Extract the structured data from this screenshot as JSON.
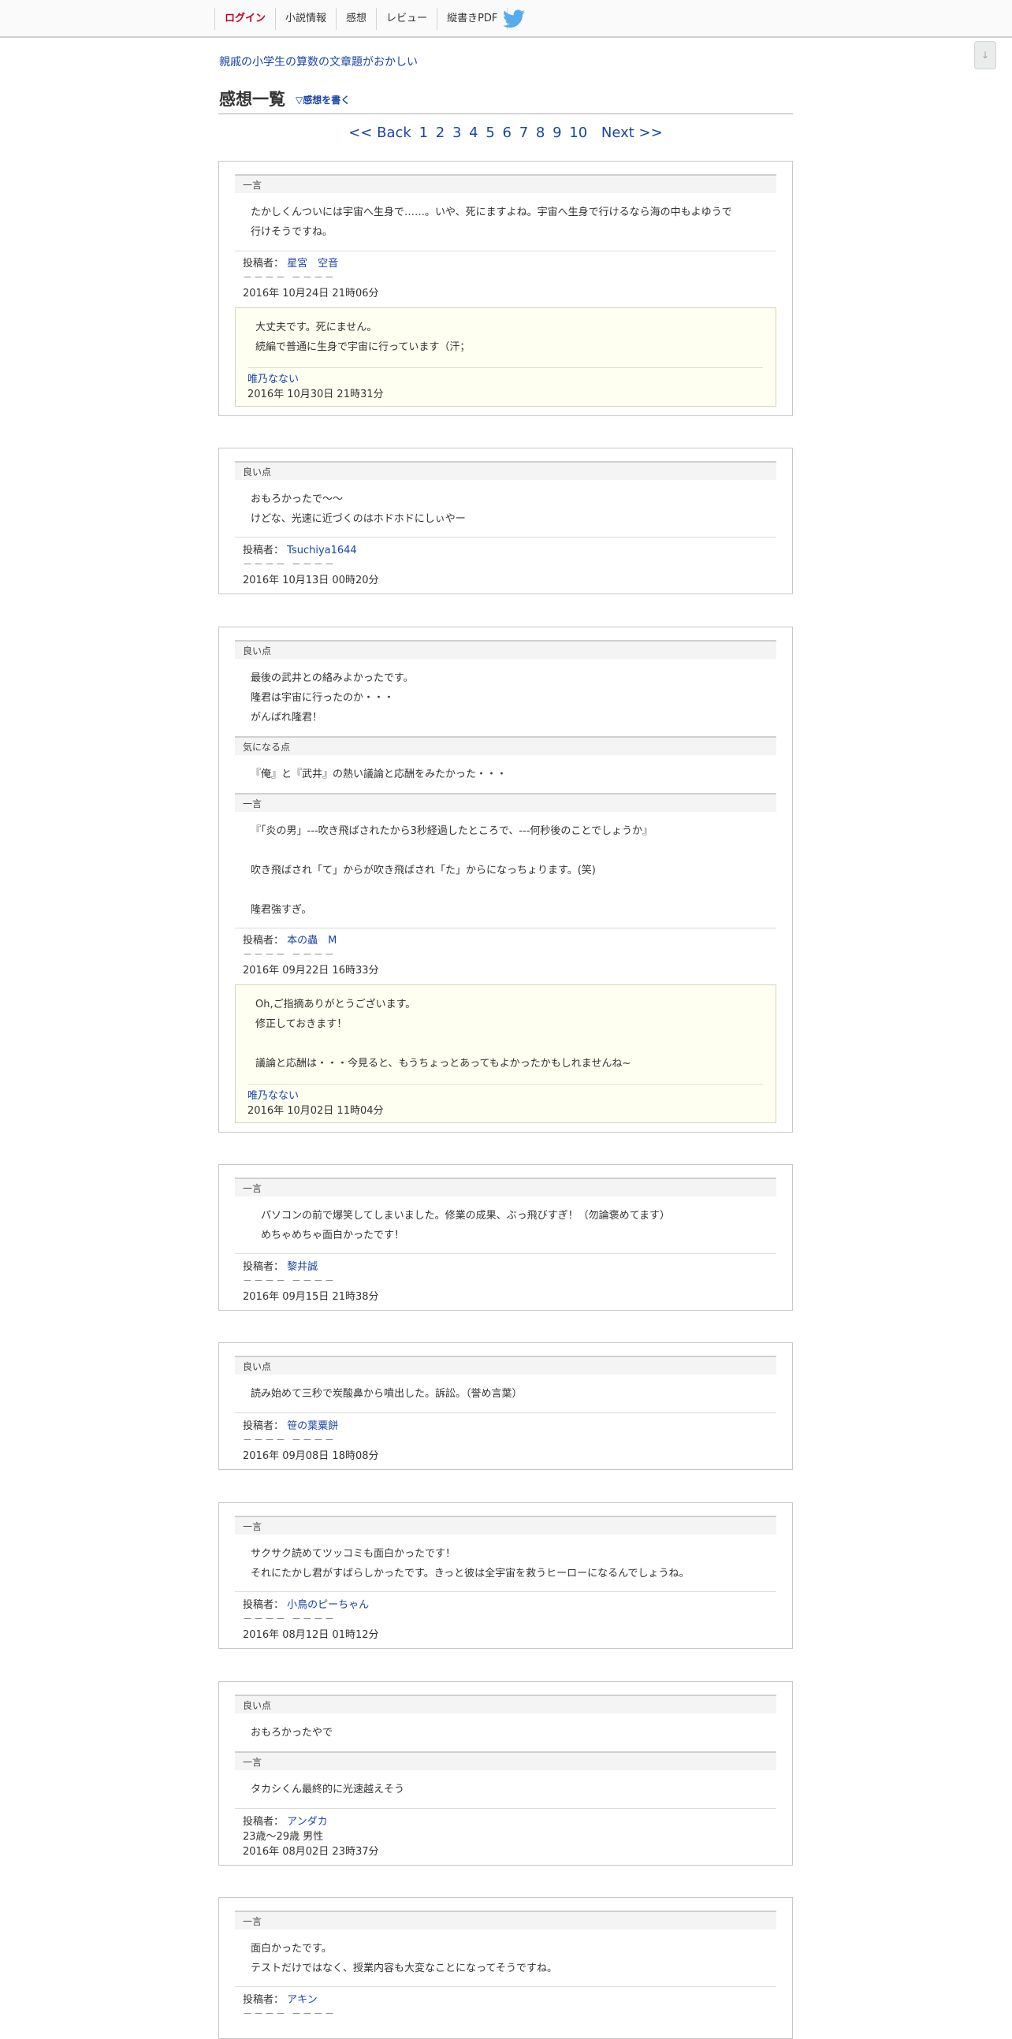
{
  "nav": {
    "items": [
      "ログイン",
      "小説情報",
      "感想",
      "レビュー",
      "縦書きPDF"
    ],
    "twitter_icon": "twitter-bird-icon",
    "twitter_color": "#55acee"
  },
  "scroll_button": "↓",
  "work_title": "親戚の小学生の算数の文章題がおかしい",
  "page_title": "感想一覧",
  "write_link": "▽感想を書く",
  "pager": {
    "back": "<< Back",
    "pages": [
      "1",
      "2",
      "3",
      "4",
      "5",
      "6",
      "7",
      "8",
      "9",
      "10"
    ],
    "next": "Next >>"
  },
  "labels": {
    "author_prefix": "投稿者："
  },
  "cards": [
    {
      "sections": [
        {
          "label": "一言",
          "text": "たかしくんついには宇宙へ生身で……。いや、死にますよね。宇宙へ生身で行けるなら海の中もよゆうで\n行けそうですね。"
        }
      ],
      "author": "星宮　空音",
      "meta": "－－－－ －－－－",
      "date": "2016年 10月24日 21時06分",
      "reply": {
        "text": "大丈夫です。死にません。\n続編で普通に生身で宇宙に行っています（汗；",
        "author": "唯乃なない",
        "date": "2016年 10月30日 21時31分"
      }
    },
    {
      "sections": [
        {
          "label": "良い点",
          "text": "おもろかったで～～\nけどな、光速に近づくのはホドホドにしぃやー"
        }
      ],
      "author": "Tsuchiya1644",
      "meta": "－－－－ －－－－",
      "date": "2016年 10月13日 00時20分"
    },
    {
      "sections": [
        {
          "label": "良い点",
          "text": "最後の武井との絡みよかったです。\n隆君は宇宙に行ったのか・・・\nがんばれ隆君！"
        },
        {
          "label": "気になる点",
          "text": "『俺』と『武井』の熱い議論と応酬をみたかった・・・"
        },
        {
          "label": "一言",
          "text": "『「炎の男」---吹き飛ばされたから3秒経過したところで、---何秒後のことでしょうか』\n\n吹き飛ばされ「て」からが吹き飛ばされ「た」からになっちょります。(笑)\n\n隆君強すぎ。"
        }
      ],
      "author": "本の蟲　M",
      "meta": "－－－－ －－－－",
      "date": "2016年 09月22日 16時33分",
      "reply": {
        "text": "Oh,ご指摘ありがとうございます。\n修正しておきます！\n\n議論と応酬は・・・今見ると、もうちょっとあってもよかったかもしれませんね~",
        "author": "唯乃なない",
        "date": "2016年 10月02日 11時04分"
      }
    },
    {
      "sections": [
        {
          "label": "一言",
          "text": "　パソコンの前で爆笑してしまいました。修業の成果、ぶっ飛びすぎ！（勿論褒めてます）\n　めちゃめちゃ面白かったです！"
        }
      ],
      "author": "黎井誠",
      "meta": "－－－－ －－－－",
      "date": "2016年 09月15日 21時38分"
    },
    {
      "sections": [
        {
          "label": "良い点",
          "text": "読み始めて三秒で炭酸鼻から噴出した。訴訟。（誉め言葉）"
        }
      ],
      "author": "笹の葉粟餅",
      "meta": "－－－－ －－－－",
      "date": "2016年 09月08日 18時08分"
    },
    {
      "sections": [
        {
          "label": "一言",
          "text": "サクサク読めてツッコミも面白かったです！\nそれにたかし君がすばらしかったです。きっと彼は全宇宙を救うヒーローになるんでしょうね。"
        }
      ],
      "author": "小鳥のピーちゃん",
      "meta": "－－－－ －－－－",
      "date": "2016年 08月12日 01時12分"
    },
    {
      "sections": [
        {
          "label": "良い点",
          "text": "おもろかったやで"
        },
        {
          "label": "一言",
          "text": "タカシくん最終的に光速越えそう"
        }
      ],
      "author": "アンダカ",
      "meta": "23歳～29歳 男性",
      "date": "2016年 08月02日 23時37分"
    },
    {
      "sections": [
        {
          "label": "一言",
          "text": "面白かったです。\nテストだけではなく、授業内容も大変なことになってそうですね。"
        }
      ],
      "author": "アキン",
      "meta": "－－－－ －－－－",
      "date": ""
    }
  ]
}
